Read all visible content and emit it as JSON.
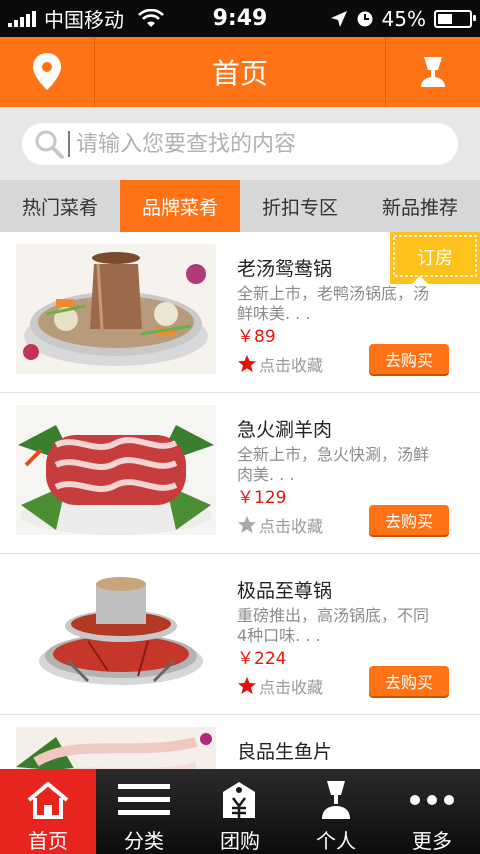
{
  "status_bar": {
    "carrier": "中国移动",
    "time": "9:49",
    "battery": "45%",
    "battery_level": 0.45
  },
  "nav": {
    "title": "首页",
    "left_icon": "location-pin-icon",
    "right_icon": "user-cup-icon"
  },
  "search": {
    "placeholder": "请输入您要查找的内容"
  },
  "tabs": [
    {
      "label": "热门菜肴",
      "active": false
    },
    {
      "label": "品牌菜肴",
      "active": true
    },
    {
      "label": "折扣专区",
      "active": false
    },
    {
      "label": "新品推荐",
      "active": false
    }
  ],
  "ribbon": {
    "label": "订房"
  },
  "items": [
    {
      "name": "老汤鸳鸯锅",
      "desc": "全新上市，老鸭汤锅底，汤鲜味美. . .",
      "price": "￥89",
      "fav_label": "点击收藏",
      "favorited": true,
      "buy_label": "去购买"
    },
    {
      "name": "急火涮羊肉",
      "desc": "全新上市，急火快涮，汤鲜肉美. . .",
      "price": "￥129",
      "fav_label": "点击收藏",
      "favorited": false,
      "buy_label": "去购买"
    },
    {
      "name": "极品至尊锅",
      "desc": "重磅推出，高汤锅底，不同4种口味. . .",
      "price": "￥224",
      "fav_label": "点击收藏",
      "favorited": true,
      "buy_label": "去购买"
    },
    {
      "name": "良品生鱼片",
      "desc": "",
      "price": "",
      "fav_label": "",
      "favorited": false,
      "buy_label": ""
    }
  ],
  "tabbar": [
    {
      "label": "首页",
      "icon": "home-icon",
      "active": true
    },
    {
      "label": "分类",
      "icon": "menu-list-icon",
      "active": false
    },
    {
      "label": "团购",
      "icon": "price-tag-icon",
      "active": false
    },
    {
      "label": "个人",
      "icon": "person-icon",
      "active": false
    },
    {
      "label": "更多",
      "icon": "more-dots-icon",
      "active": false
    }
  ],
  "colors": {
    "accent": "#fd7315",
    "tabbar_active": "#e8241e",
    "price": "#e8160c",
    "ribbon": "#ffc21d"
  }
}
